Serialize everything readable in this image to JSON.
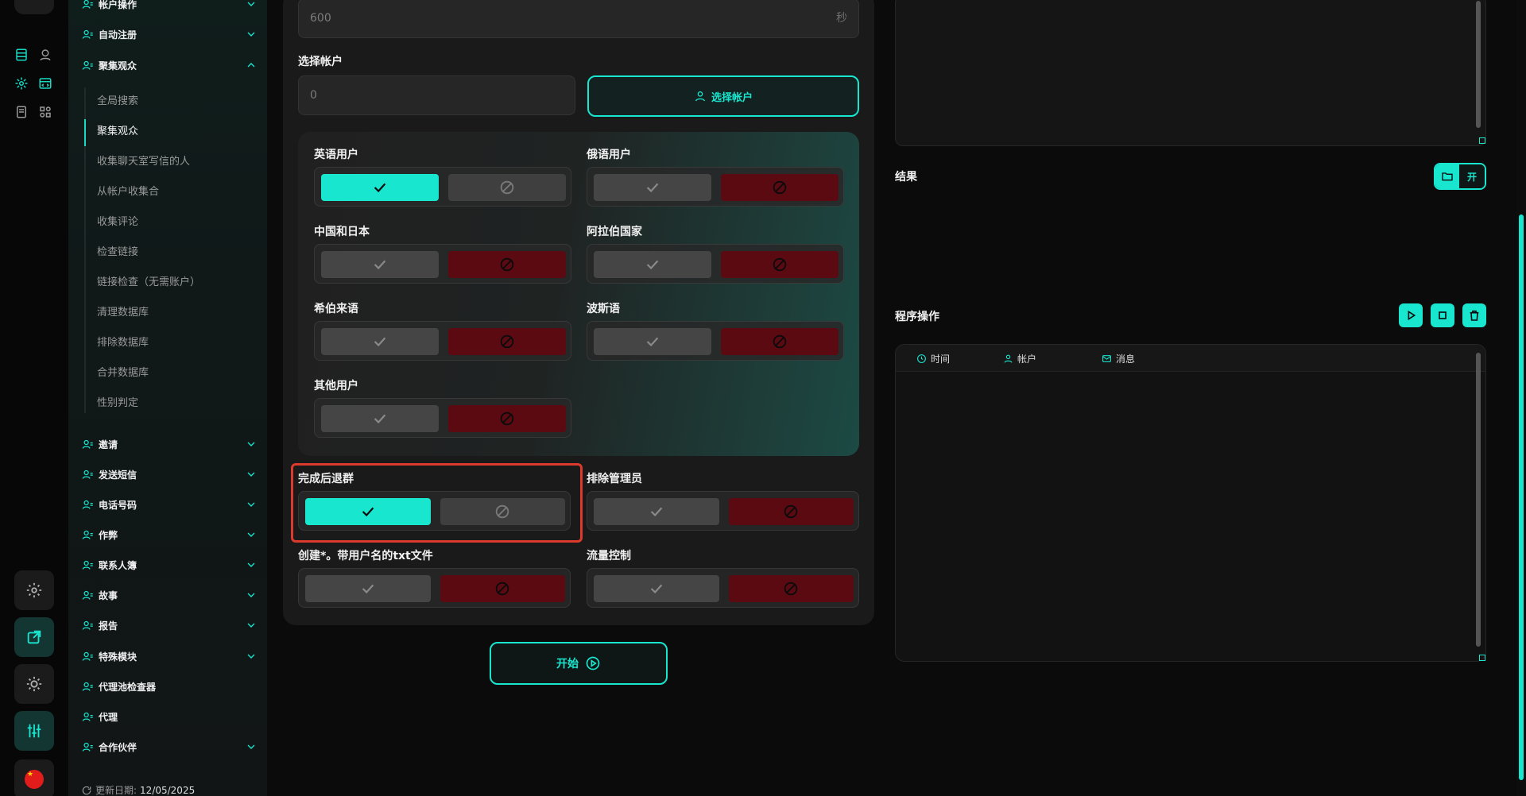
{
  "sidebar": {
    "sections": [
      {
        "label": "帐户操作",
        "icon": "user-gear-icon",
        "expanded": false
      },
      {
        "label": "自动注册",
        "icon": "user-plus-icon",
        "expanded": false
      },
      {
        "label": "聚集观众",
        "icon": "users-list-icon",
        "expanded": true
      },
      {
        "label": "邀请",
        "icon": "user-list-icon",
        "expanded": false
      },
      {
        "label": "发送短信",
        "icon": "send-icon",
        "expanded": false
      },
      {
        "label": "电话号码",
        "icon": "phone-icon",
        "expanded": false
      },
      {
        "label": "作弊",
        "icon": "paper-plane-icon",
        "expanded": false
      },
      {
        "label": "联系人簿",
        "icon": "contacts-icon",
        "expanded": false
      },
      {
        "label": "故事",
        "icon": "plus-square-icon",
        "expanded": false
      },
      {
        "label": "报告",
        "icon": "report-icon",
        "expanded": false
      },
      {
        "label": "特殊模块",
        "icon": "grid-icon",
        "expanded": false
      },
      {
        "label": "代理池检查器",
        "icon": "gauge-icon",
        "expanded": false
      },
      {
        "label": "代理",
        "icon": "network-icon",
        "expanded": false
      },
      {
        "label": "合作伙伴",
        "icon": "thumb-icon",
        "expanded": false
      }
    ],
    "sub_items": [
      "全局搜索",
      "聚集观众",
      "收集聊天室写信的人",
      "从帐户收集合",
      "收集评论",
      "检查链接",
      "链接检查（无需账户）",
      "清理数据库",
      "排除数据库",
      "合并数据库",
      "性别判定"
    ],
    "active_sub": "聚集观众",
    "update_label": "更新日期:",
    "update_value": "12/05/2025"
  },
  "form": {
    "delay_value": "600",
    "delay_unit": "秒",
    "select_account_label": "选择帐户",
    "account_count": "0",
    "select_account_button": "选择帐户",
    "languages": [
      {
        "label": "英语用户",
        "state": "yes"
      },
      {
        "label": "俄语用户",
        "state": "no"
      },
      {
        "label": "中国和日本",
        "state": "no"
      },
      {
        "label": "阿拉伯国家",
        "state": "no"
      },
      {
        "label": "希伯来语",
        "state": "no"
      },
      {
        "label": "波斯语",
        "state": "no"
      },
      {
        "label": "其他用户",
        "state": "no"
      }
    ],
    "options": [
      {
        "label": "完成后退群",
        "state": "yes"
      },
      {
        "label": "排除管理员",
        "state": "no"
      },
      {
        "label": "创建*。带用户名的txt文件",
        "state": "no"
      },
      {
        "label": "流量控制",
        "state": "no"
      }
    ],
    "start_button": "开始"
  },
  "right": {
    "result_label": "结果",
    "open_button": "开",
    "program_ops_label": "程序操作",
    "log_columns": [
      "时间",
      "帐户",
      "消息"
    ]
  },
  "colors": {
    "accent": "#18e6cf",
    "reject": "#5b0a12",
    "highlight": "#dc3a2c"
  }
}
